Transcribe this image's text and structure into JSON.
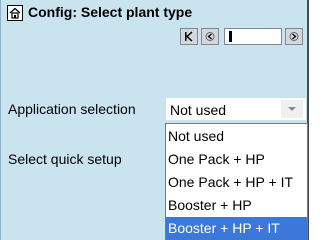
{
  "header": {
    "title": "Config: Select plant type",
    "home_icon": "home-icon"
  },
  "navigator": {
    "first_icon": "first-page-icon",
    "prev_icon": "prev-page-icon",
    "next_icon": "next-page-icon"
  },
  "fields": {
    "application_label": "Application selection",
    "application_value": "Not used",
    "quick_setup_label": "Select quick setup"
  },
  "dropdown": {
    "options": [
      "Not used",
      "One Pack + HP",
      "One Pack + HP + IT",
      "Booster + HP",
      "Booster + HP + IT"
    ],
    "selected_index": 4
  },
  "colors": {
    "panel_bg": "#c9e3ef",
    "selection": "#3c78d8"
  }
}
